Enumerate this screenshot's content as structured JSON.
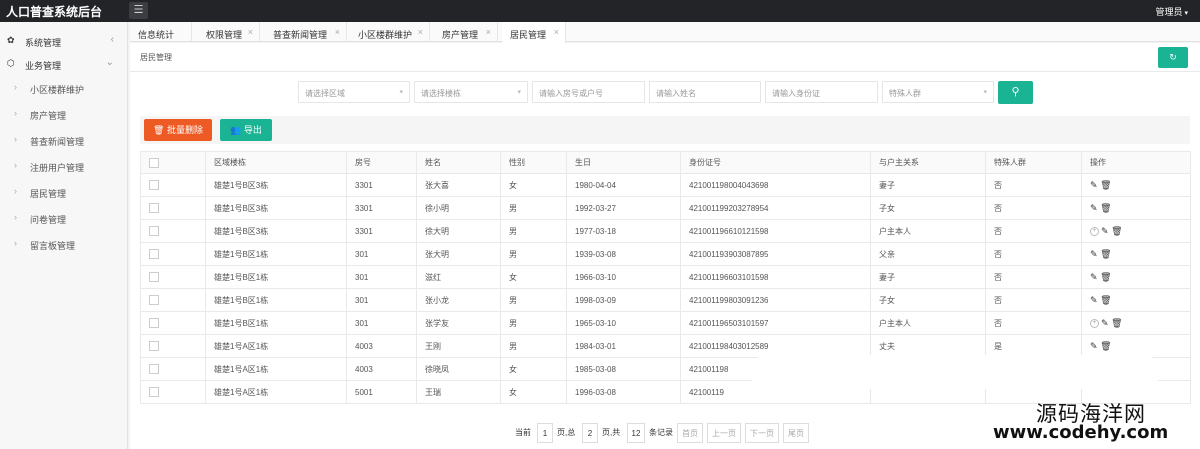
{
  "header": {
    "title": "人口普查系统后台",
    "menu_icon": "☰",
    "user": "管理员",
    "user_caret": "▾"
  },
  "sidebar": {
    "groups": [
      {
        "icon": "gear-icon",
        "glyph": "✿",
        "label": "系统管理",
        "chevron": "‹"
      },
      {
        "icon": "cube-icon",
        "glyph": "⬡",
        "label": "业务管理",
        "chevron": "⌄"
      }
    ],
    "items": [
      {
        "label": "小区楼群维护"
      },
      {
        "label": "房产管理"
      },
      {
        "label": "普查新闻管理"
      },
      {
        "label": "注册用户管理"
      },
      {
        "label": "居民管理"
      },
      {
        "label": "问卷管理"
      },
      {
        "label": "留言板管理"
      }
    ],
    "item_chevron": "›"
  },
  "tabs": [
    {
      "label": "信息统计",
      "closable": false
    },
    {
      "label": "权限管理",
      "closable": true
    },
    {
      "label": "普查新闻管理",
      "closable": true
    },
    {
      "label": "小区楼群维护",
      "closable": true
    },
    {
      "label": "房产管理",
      "closable": true
    },
    {
      "label": "居民管理",
      "closable": true,
      "active": true
    }
  ],
  "tab_close": "×",
  "breadcrumb": "居民管理",
  "refresh_glyph": "↻",
  "filters": {
    "area": "请选择区域",
    "building": "请选择楼栋",
    "room": "请输入房号或户号",
    "name": "请输入姓名",
    "idcard": "请输入身份证",
    "special": "特殊人群",
    "dropdown_glyph": "▾",
    "search_glyph": "⚲"
  },
  "toolbar": {
    "delete_label": "批量删除",
    "delete_glyph": "🗑",
    "export_label": "导出",
    "export_glyph": "👥"
  },
  "table": {
    "headers": [
      "区域楼栋",
      "房号",
      "姓名",
      "性别",
      "生日",
      "身份证号",
      "与户主关系",
      "特殊人群",
      "操作"
    ],
    "rows": [
      [
        "雄楚1号B区3栋",
        "3301",
        "张大喜",
        "女",
        "1980-04-04",
        "421001198004043698",
        "妻子",
        "否",
        "edit"
      ],
      [
        "雄楚1号B区3栋",
        "3301",
        "徐小明",
        "男",
        "1992-03-27",
        "421001199203278954",
        "子女",
        "否",
        "edit"
      ],
      [
        "雄楚1号B区3栋",
        "3301",
        "徐大明",
        "男",
        "1977-03-18",
        "421001196610121598",
        "户主本人",
        "否",
        "full"
      ],
      [
        "雄楚1号B区1栋",
        "301",
        "张大明",
        "男",
        "1939-03-08",
        "421001193903087895",
        "父亲",
        "否",
        "edit"
      ],
      [
        "雄楚1号B区1栋",
        "301",
        "滋红",
        "女",
        "1966-03-10",
        "421001196603101598",
        "妻子",
        "否",
        "edit"
      ],
      [
        "雄楚1号B区1栋",
        "301",
        "张小龙",
        "男",
        "1998-03-09",
        "421001199803091236",
        "子女",
        "否",
        "edit"
      ],
      [
        "雄楚1号B区1栋",
        "301",
        "张学友",
        "男",
        "1965-03-10",
        "421001196503101597",
        "户主本人",
        "否",
        "full"
      ],
      [
        "雄楚1号A区1栋",
        "4003",
        "王刚",
        "男",
        "1984-03-01",
        "421001198403012589",
        "丈夫",
        "是",
        "edit"
      ],
      [
        "雄楚1号A区1栋",
        "4003",
        "徐晓凤",
        "女",
        "1985-03-08",
        "421001198",
        "",
        "",
        ""
      ],
      [
        "雄楚1号A区1栋",
        "5001",
        "王瑞",
        "女",
        "1996-03-08",
        "42100119",
        "",
        "",
        ""
      ]
    ],
    "edit_glyph": "✎",
    "delete_glyph": "🗑",
    "more_glyph": "+"
  },
  "pager": {
    "current_label": "当前",
    "current": "1",
    "total_pages_label": "页,总",
    "total_pages": "2",
    "total_label": "页,共",
    "total": "12",
    "records_label": "条记录",
    "first": "首页",
    "prev": "上一页",
    "next": "下一页",
    "last": "尾页"
  },
  "watermark": {
    "line1": "源码海洋网",
    "line2": "www.codehy.com"
  }
}
